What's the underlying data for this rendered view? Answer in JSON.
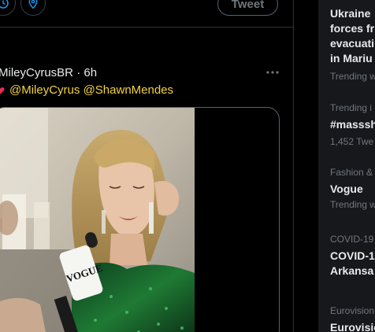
{
  "composer": {
    "tweet_button_label": "Tweet",
    "icons": [
      "schedule-icon",
      "location-icon"
    ]
  },
  "tweet": {
    "author_display": "MileyCyrusBR",
    "separator": "·",
    "time": "6h",
    "more_icon": "more-horizontal-icon",
    "emoji": "sparkling-heart",
    "mentions": "@MileyCyrus @ShawnMendes",
    "media": {
      "microphone_brand": "VOGUE"
    }
  },
  "trends": {
    "items": [
      {
        "title_lines": [
          "Ukraine",
          "forces fr",
          "evacuati",
          "in Mariu"
        ],
        "meta": "Trending w"
      },
      {
        "meta": "Trending i",
        "title": "#masssh",
        "count": "1,452 Twe"
      },
      {
        "meta": "Fashion &",
        "title": "Vogue",
        "sub": "Trending w"
      },
      {
        "meta": "COVID-19",
        "title_lines": [
          "COVID-1",
          "Arkansa"
        ]
      },
      {
        "meta": "Eurovision",
        "title": "Eurovisio"
      }
    ]
  },
  "colors": {
    "background": "#000000",
    "text_primary": "#e7e9ea",
    "text_secondary": "#71767b",
    "mention_yellow": "#f5d33b",
    "sidebar_bg": "#16181c",
    "border": "#2f3336"
  }
}
